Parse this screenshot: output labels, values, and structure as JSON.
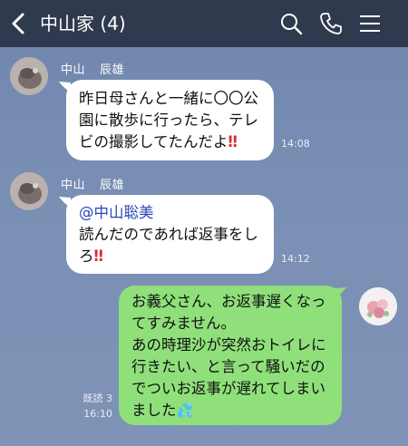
{
  "header": {
    "title": "中山家 (4)",
    "icons": [
      "back-icon",
      "search-icon",
      "phone-icon",
      "menu-icon"
    ]
  },
  "messages": [
    {
      "direction": "incoming",
      "sender_name": "中山",
      "sender_given": "辰雄",
      "lines": [
        "昨日母さんと一緒に〇〇公",
        "園に散歩に行ったら、テレ",
        "ビの撮影してたんだよ"
      ],
      "emoji_tail": "‼",
      "time": "14:08"
    },
    {
      "direction": "incoming",
      "sender_name": "中山",
      "sender_given": "辰雄",
      "mention": "@中山聡美",
      "lines": [
        "読んだのであれば返事をし",
        "ろ"
      ],
      "emoji_tail": "‼",
      "time": "14:12"
    },
    {
      "direction": "outgoing",
      "lines": [
        "お義父さん、お返事遅くなっ",
        "てすみません。",
        "あの時理沙が突然おトイレに",
        "行きたい、と言って騒いだの",
        "でついお返事が遅れてしまい",
        "ました"
      ],
      "emoji_tail": "💦",
      "read_status": "既読 3",
      "time": "16:10"
    }
  ],
  "colors": {
    "header_bg": "#2f3a4e",
    "chat_bg": "#7a8fb4",
    "incoming_bubble": "#ffffff",
    "outgoing_bubble": "#8fe07a",
    "mention": "#2a46b8",
    "exclamation": "#e12a2a"
  }
}
